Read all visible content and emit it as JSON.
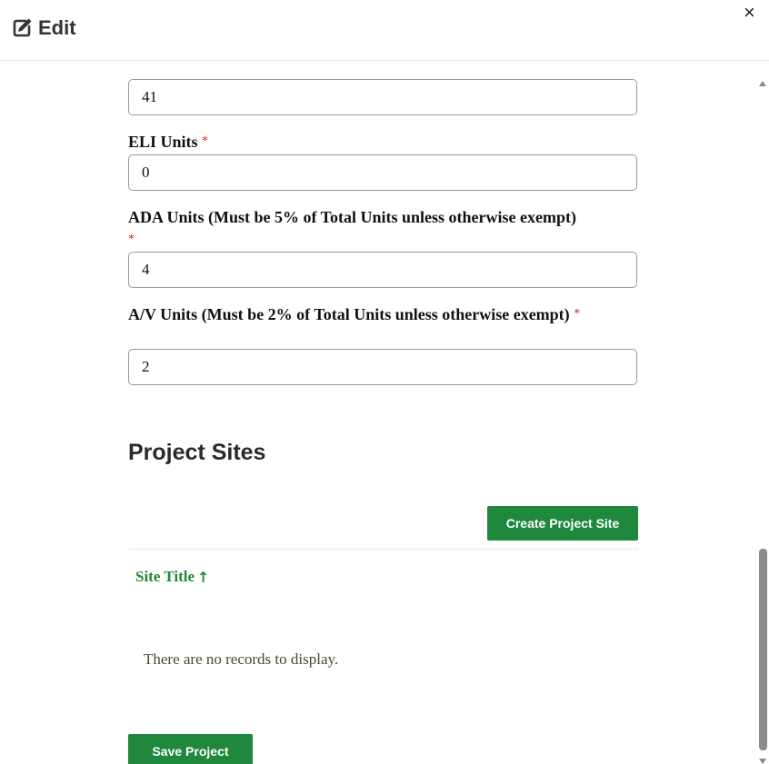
{
  "header": {
    "title": "Edit",
    "edit_icon": "edit-pencil-square-icon",
    "close_label": "×"
  },
  "form": {
    "total_units_value": "41",
    "eli_units_label": "ELI Units",
    "eli_units_value": "0",
    "ada_units_label": "ADA Units (Must be 5% of Total Units unless otherwise exempt)",
    "ada_units_value": "4",
    "av_units_label": "A/V Units (Must be 2% of Total Units unless otherwise exempt)",
    "av_units_value": "2",
    "required_marker": "*"
  },
  "project_sites": {
    "title": "Project Sites",
    "create_button": "Create Project Site",
    "columns": [
      {
        "label": "Site Title",
        "sort_indicator": "↑"
      }
    ],
    "empty_message": "There are no records to display."
  },
  "footer": {
    "save_button": "Save Project"
  },
  "colors": {
    "primary_green": "#1f883d",
    "required_red": "#e02020"
  }
}
